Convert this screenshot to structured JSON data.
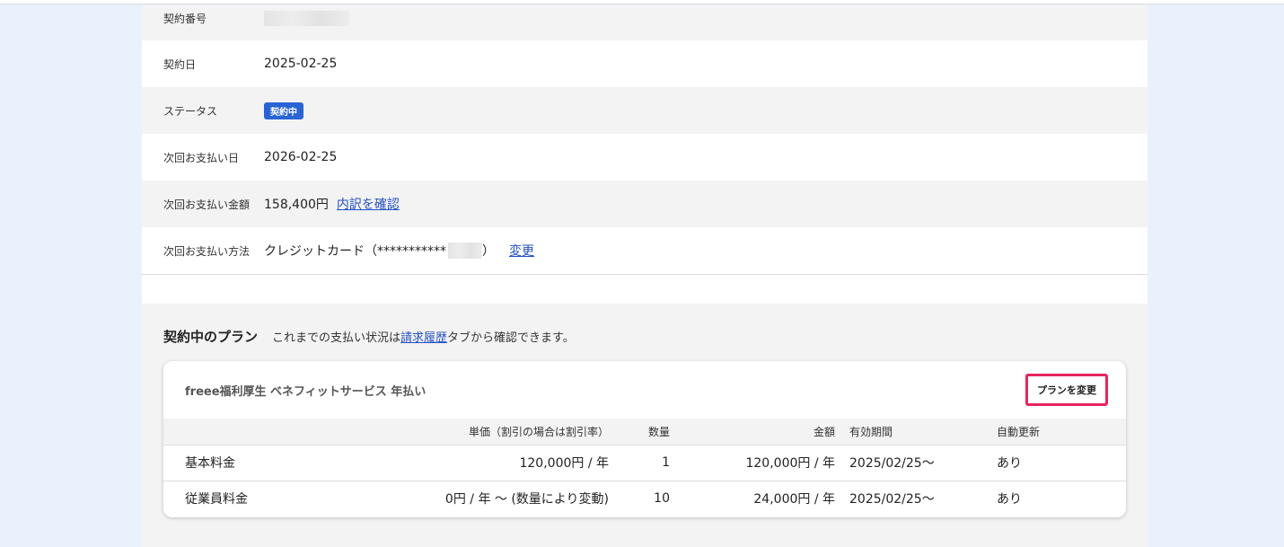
{
  "contract": {
    "rows": [
      {
        "label": "契約番号",
        "value": ""
      },
      {
        "label": "契約日",
        "value": "2025-02-25"
      },
      {
        "label": "ステータス",
        "badge": "契約中"
      },
      {
        "label": "次回お支払い日",
        "value": "2026-02-25"
      },
      {
        "label": "次回お支払い金額",
        "value": "158,400円",
        "link": "内訳を確認"
      },
      {
        "label": "次回お支払い方法",
        "value": "クレジットカード（***********",
        "value_end": "）",
        "link": "変更"
      }
    ]
  },
  "plan_section": {
    "title": "契約中のプラン",
    "note_before": "これまでの支払い状況は",
    "note_link": "請求履歴",
    "note_after": "タブから確認できます。"
  },
  "plan_card": {
    "title": "freee福利厚生 ベネフィットサービス 年払い",
    "change_button": "プランを変更",
    "columns": [
      "",
      "単価（割引の場合は割引率）",
      "数量",
      "金額",
      "有効期間",
      "自動更新"
    ],
    "rows": [
      {
        "name": "基本料金",
        "price": "120,000円 / 年",
        "qty": "1",
        "amount": "120,000円 / 年",
        "period": "2025/02/25〜",
        "auto": "あり"
      },
      {
        "name": "従業員料金",
        "price": "0円 / 年 〜 (数量により変動)",
        "qty": "10",
        "amount": "24,000円 / 年",
        "period": "2025/02/25〜",
        "auto": "あり"
      }
    ]
  },
  "colors": {
    "badge": "#2864d4",
    "link": "#2251c6",
    "highlight_border": "#e8245f",
    "page_bg": "#e9f1fc"
  }
}
